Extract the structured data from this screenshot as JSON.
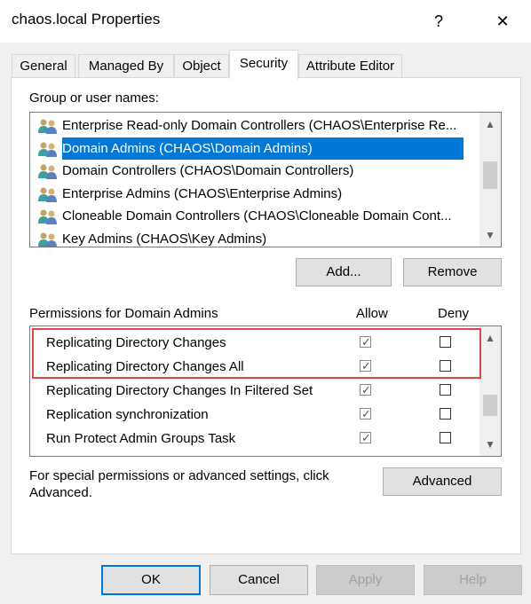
{
  "window": {
    "title": "chaos.local Properties",
    "help_label": "?",
    "close_label": "✕"
  },
  "tabs": [
    {
      "label": "General",
      "active": false
    },
    {
      "label": "Managed By",
      "active": false
    },
    {
      "label": "Object",
      "active": false
    },
    {
      "label": "Security",
      "active": true
    },
    {
      "label": "Attribute Editor",
      "active": false
    }
  ],
  "security": {
    "group_label": "Group or user names:",
    "users": [
      {
        "name": "Enterprise Read-only Domain Controllers (CHAOS\\Enterprise Re...",
        "icon": "users-group-icon",
        "selected": false
      },
      {
        "name": "Domain Admins (CHAOS\\Domain Admins)",
        "icon": "users-group-icon",
        "selected": true
      },
      {
        "name": "Domain Controllers (CHAOS\\Domain Controllers)",
        "icon": "users-group-icon",
        "selected": false
      },
      {
        "name": "Enterprise Admins (CHAOS\\Enterprise Admins)",
        "icon": "users-group-icon",
        "selected": false
      },
      {
        "name": "Cloneable Domain Controllers (CHAOS\\Cloneable Domain Cont...",
        "icon": "users-group-icon",
        "selected": false
      },
      {
        "name": "Key Admins (CHAOS\\Key Admins)",
        "icon": "users-group-icon",
        "selected": false
      }
    ],
    "add_label": "Add...",
    "remove_label": "Remove",
    "permissions_label": "Permissions for Domain Admins",
    "allow_header": "Allow",
    "deny_header": "Deny",
    "permissions": [
      {
        "name": "Replicating Directory Changes",
        "allow": true,
        "deny": false,
        "highlighted": true
      },
      {
        "name": "Replicating Directory Changes All",
        "allow": true,
        "deny": false,
        "highlighted": true
      },
      {
        "name": "Replicating Directory Changes In Filtered Set",
        "allow": true,
        "deny": false,
        "highlighted": false
      },
      {
        "name": "Replication synchronization",
        "allow": true,
        "deny": false,
        "highlighted": false
      },
      {
        "name": "Run Protect Admin Groups Task",
        "allow": true,
        "deny": false,
        "highlighted": false
      }
    ],
    "special_text_line1": "For special permissions or advanced settings, click",
    "special_text_line2": "Advanced.",
    "advanced_label": "Advanced"
  },
  "footer": {
    "ok_label": "OK",
    "cancel_label": "Cancel",
    "apply_label": "Apply",
    "help_label": "Help"
  },
  "colors": {
    "selection": "#0078d7",
    "highlight_box": "#e0454a",
    "default_button_border": "#0078d7"
  }
}
